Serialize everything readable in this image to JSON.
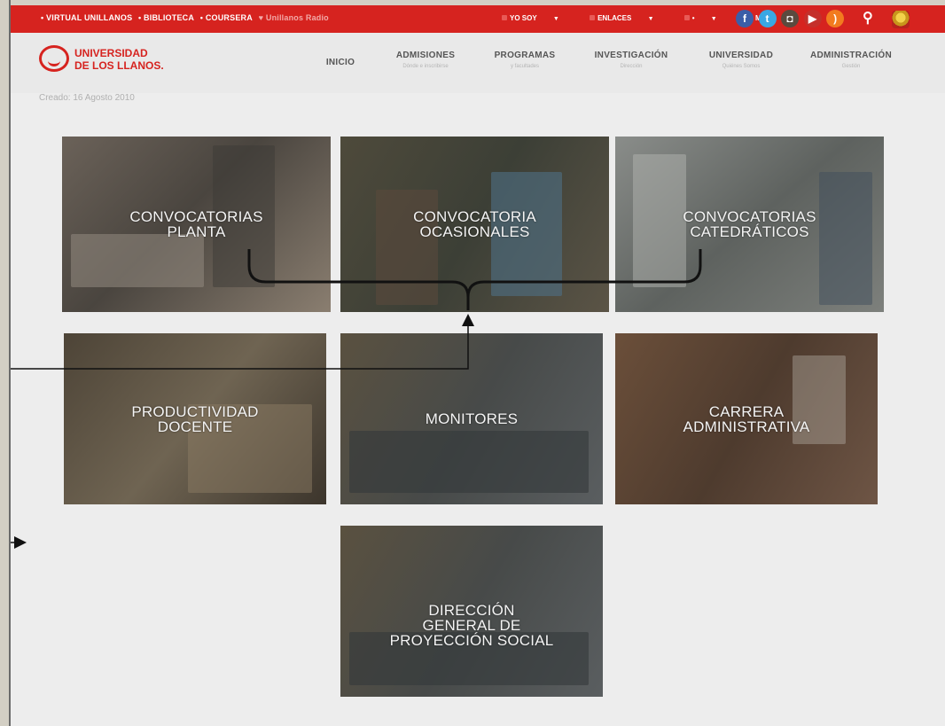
{
  "topbar": {
    "links": [
      "• VIRTUAL UNILLANOS",
      "• BIBLIOTECA",
      "• COURSERA"
    ],
    "radio": "Unillanos Radio",
    "menus": [
      "YO SOY",
      "ENLACES",
      "•",
      "MÁS"
    ],
    "social_icons": [
      "facebook-icon",
      "twitter-icon",
      "instagram-icon",
      "youtube-icon",
      "rss-icon"
    ],
    "colors": {
      "bar": "#d6231f"
    }
  },
  "logo": {
    "line1": "UNIVERSIDAD",
    "line2": "DE LOS LLANOS."
  },
  "nav": [
    {
      "title": "INICIO",
      "sub": ""
    },
    {
      "title": "ADMISIONES",
      "sub": "Dónde e inscribirse"
    },
    {
      "title": "PROGRAMAS",
      "sub": "y facultades"
    },
    {
      "title": "INVESTIGACIÓN",
      "sub": "Dirección"
    },
    {
      "title": "UNIVERSIDAD",
      "sub": "Quiénes Somos"
    },
    {
      "title": "ADMINISTRACIÓN",
      "sub": "Gestión"
    }
  ],
  "created": "Creado: 16 Agosto 2010",
  "tiles": [
    {
      "label": "CONVOCATORIAS\nPLANTA"
    },
    {
      "label": "CONVOCATORIA\nOCASIONALES"
    },
    {
      "label": "CONVOCATORIAS\nCATEDRÁTICOS"
    },
    {
      "label": "PRODUCTIVIDAD\nDOCENTE"
    },
    {
      "label": "MONITORES"
    },
    {
      "label": "CARRERA\nADMINISTRATIVA"
    },
    {
      "label": "DIRECCIÓN\nGENERAL DE\nPROYECCIÓN SOCIAL"
    }
  ]
}
